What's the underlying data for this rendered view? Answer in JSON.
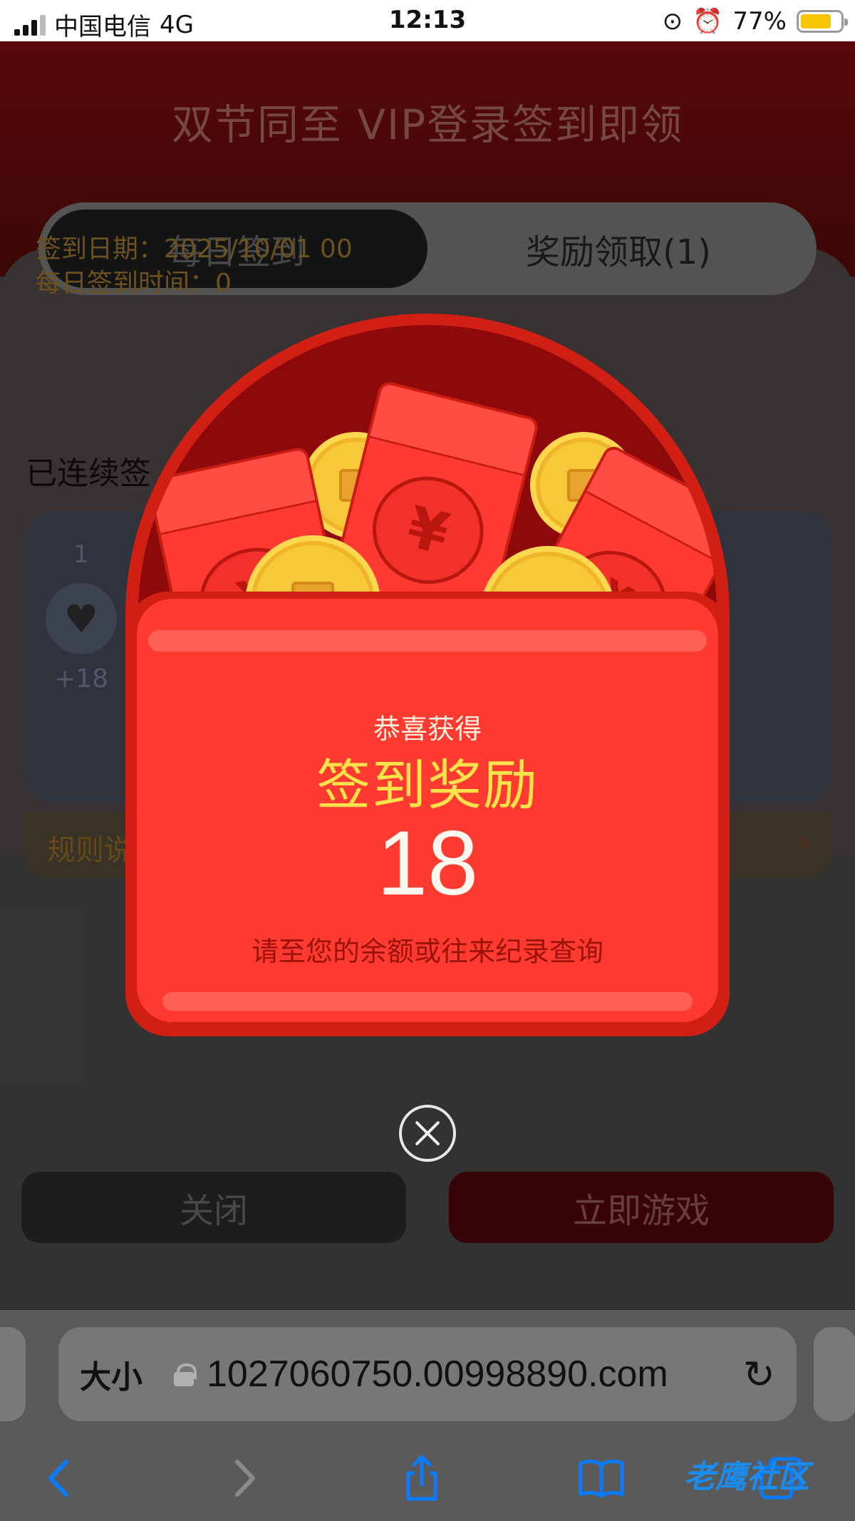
{
  "status_bar": {
    "carrier": "中国电信",
    "network": "4G",
    "time": "12:13",
    "battery": "77%",
    "battery_level": 0.77
  },
  "page": {
    "banner_title": "双节同至 VIP登录签到即领",
    "tabs": [
      {
        "label": "每日签到",
        "active": true
      },
      {
        "label": "奖励领取(1)",
        "active": false
      }
    ],
    "sign_date": "签到日期：2025/10/01 00",
    "sign_time": "每日签到时间：0",
    "streak_label": "已连续签",
    "day_card": {
      "day": "1",
      "icon": "heart-icon",
      "reward": "+18"
    },
    "rules_label": "规则说",
    "close_button": "关闭",
    "play_button": "立即游戏"
  },
  "modal": {
    "subtitle": "恭喜获得",
    "title": "签到奖励",
    "amount": "18",
    "note": "请至您的余额或往来纪录查询",
    "seal_glyph": "¥"
  },
  "browser": {
    "text_size_label": "大小",
    "url": "1027060750.00998890.com"
  },
  "watermark": "老鹰社区",
  "colors": {
    "envelope_red": "#ff3a30",
    "envelope_border": "#d21f13",
    "title_yellow": "#ffe14a",
    "coin_gold": "#f7c93a",
    "ios_blue": "#0a7aff"
  }
}
